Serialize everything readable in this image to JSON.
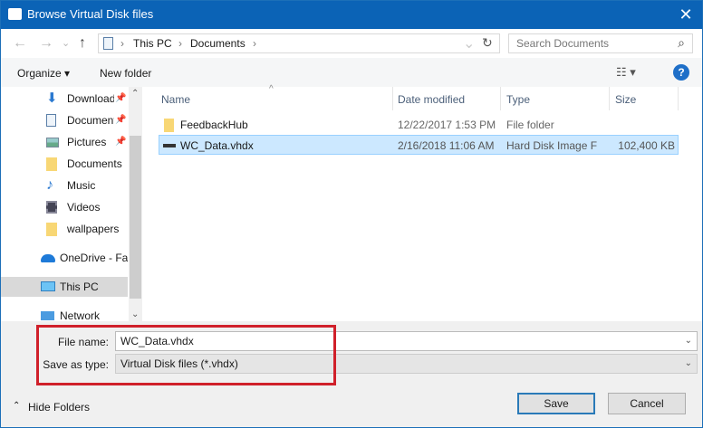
{
  "window": {
    "title": "Browse Virtual Disk files",
    "close": "✕"
  },
  "nav": {
    "back": "←",
    "forward": "→",
    "recent": "⌄",
    "up": "↑",
    "breadcrumb": [
      "This PC",
      "Documents"
    ],
    "sep": "›",
    "refresh": "↻",
    "search_placeholder": "Search Documents",
    "search_icon": "⌕"
  },
  "toolbar": {
    "organize": "Organize ▾",
    "new_folder": "New folder",
    "view": "☷ ▾",
    "help": "?"
  },
  "sidebar": {
    "items": [
      {
        "label": "Downloads",
        "icon": "download-icon",
        "pinned": true
      },
      {
        "label": "Documents",
        "icon": "document-icon",
        "pinned": true
      },
      {
        "label": "Pictures",
        "icon": "pictures-icon",
        "pinned": true
      },
      {
        "label": "Documents",
        "icon": "folder-icon"
      },
      {
        "label": "Music",
        "icon": "music-icon"
      },
      {
        "label": "Videos",
        "icon": "videos-icon"
      },
      {
        "label": "wallpapers",
        "icon": "folder-icon"
      },
      {
        "label": "OneDrive - Family",
        "icon": "onedrive-icon"
      },
      {
        "label": "This PC",
        "icon": "pc-icon",
        "selected": true
      },
      {
        "label": "Network",
        "icon": "network-icon"
      }
    ]
  },
  "list": {
    "columns": [
      "Name",
      "Date modified",
      "Type",
      "Size"
    ],
    "rows": [
      {
        "name": "FeedbackHub",
        "date": "12/22/2017 1:53 PM",
        "type": "File folder",
        "size": ""
      },
      {
        "name": "WC_Data.vhdx",
        "date": "2/16/2018 11:06 AM",
        "type": "Hard Disk Image F",
        "size": "102,400 KB",
        "selected": true
      }
    ]
  },
  "form": {
    "file_name_label": "File name:",
    "file_name": "WC_Data.vhdx",
    "type_label": "Save as type:",
    "type_value": "Virtual Disk files (*.vhdx)"
  },
  "footer": {
    "hide_folders": "Hide Folders",
    "save": "Save",
    "cancel": "Cancel"
  },
  "colors": {
    "titlebar": "#0b63b6",
    "selection": "#cce8ff",
    "highlight": "#d0202a"
  }
}
